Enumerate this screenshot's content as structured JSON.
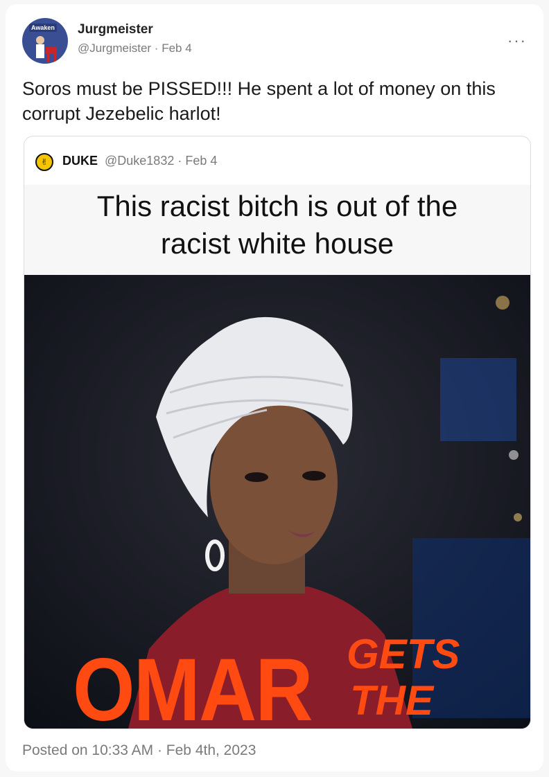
{
  "post": {
    "author_name": "Jurgmeister",
    "author_handle": "@Jurgmeister",
    "date": "Feb 4",
    "avatar_badge": "Awaken",
    "text": "Soros must be PISSED!!! He spent a lot of money on this corrupt Jezebelic harlot!",
    "more_icon": "more-dots-icon",
    "footer": "Posted on 10:33 AM · Feb 4th, 2023"
  },
  "quoted": {
    "author_name": "DUKE",
    "author_handle": "@Duke1832",
    "date": "Feb 4",
    "meme_caption": "This  racist bitch is  out of the\nracist white house",
    "banner_main": "OMAR",
    "banner_side_1": "GETS",
    "banner_side_2": "THE"
  },
  "colors": {
    "accent_orange": "#ff4a12",
    "muted_text": "#7a7a7a"
  }
}
